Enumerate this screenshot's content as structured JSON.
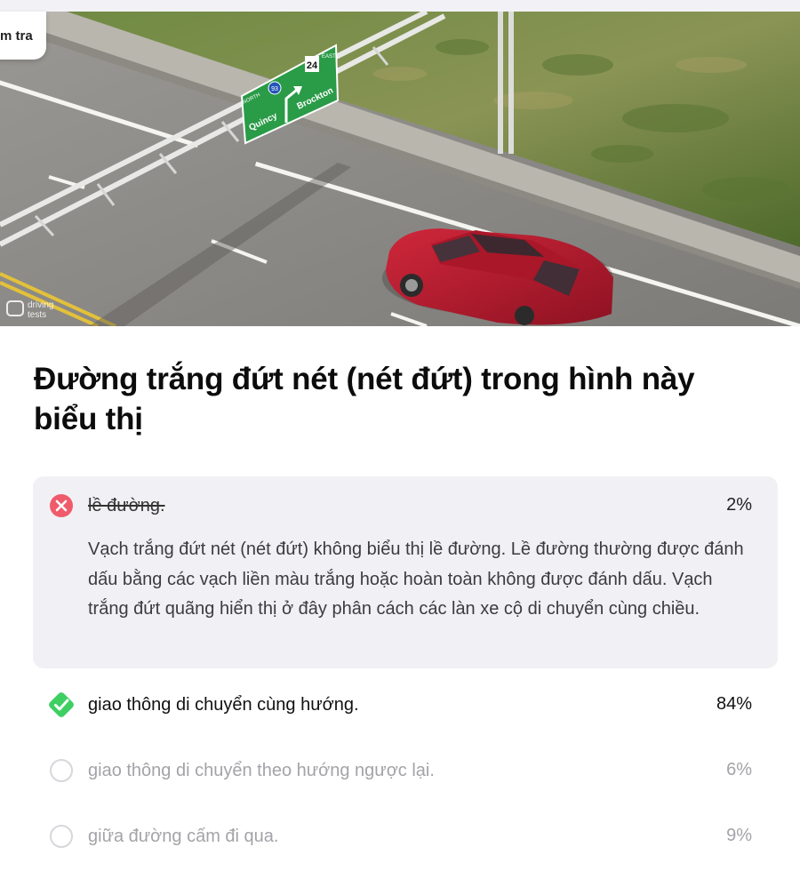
{
  "header": {
    "chip_label": "m tra"
  },
  "scene": {
    "sign": {
      "north_label": "NORTH",
      "east_label": "EAST",
      "route_north": "93",
      "route_east": "24",
      "left_destination": "Quincy",
      "right_destination": "Brockton",
      "color": "#2a9b47"
    },
    "watermark_line1": "driving",
    "watermark_line2": "tests",
    "car_color": "#b11a2c",
    "icon": "aerial-road-scene"
  },
  "question": {
    "text": "Đường trắng đứt nét (nét đứt) trong hình này biểu thị"
  },
  "answers": [
    {
      "text": "lề đường.",
      "percent": "2%",
      "state": "wrong",
      "icon": "x-circle-icon",
      "explanation": "Vạch trắng đứt nét (nét đứt) không biểu thị lề đường. Lề đường thường được đánh dấu bằng các vạch liền màu trắng hoặc hoàn toàn không được đánh dấu. Vạch trắng đứt quãng hiển thị ở đây phân cách các làn xe cộ di chuyển cùng chiều."
    },
    {
      "text": "giao thông di chuyển cùng hướng.",
      "percent": "84%",
      "state": "correct",
      "icon": "check-diamond-icon"
    },
    {
      "text": "giao thông di chuyển theo hướng ngược lại.",
      "percent": "6%",
      "state": "neutral",
      "icon": "empty-circle-icon"
    },
    {
      "text": "giữa đường cấm đi qua.",
      "percent": "9%",
      "state": "neutral",
      "icon": "empty-circle-icon"
    }
  ],
  "colors": {
    "wrong": "#ef5b6b",
    "correct": "#3ecf63",
    "panel": "#f1f1f5"
  }
}
